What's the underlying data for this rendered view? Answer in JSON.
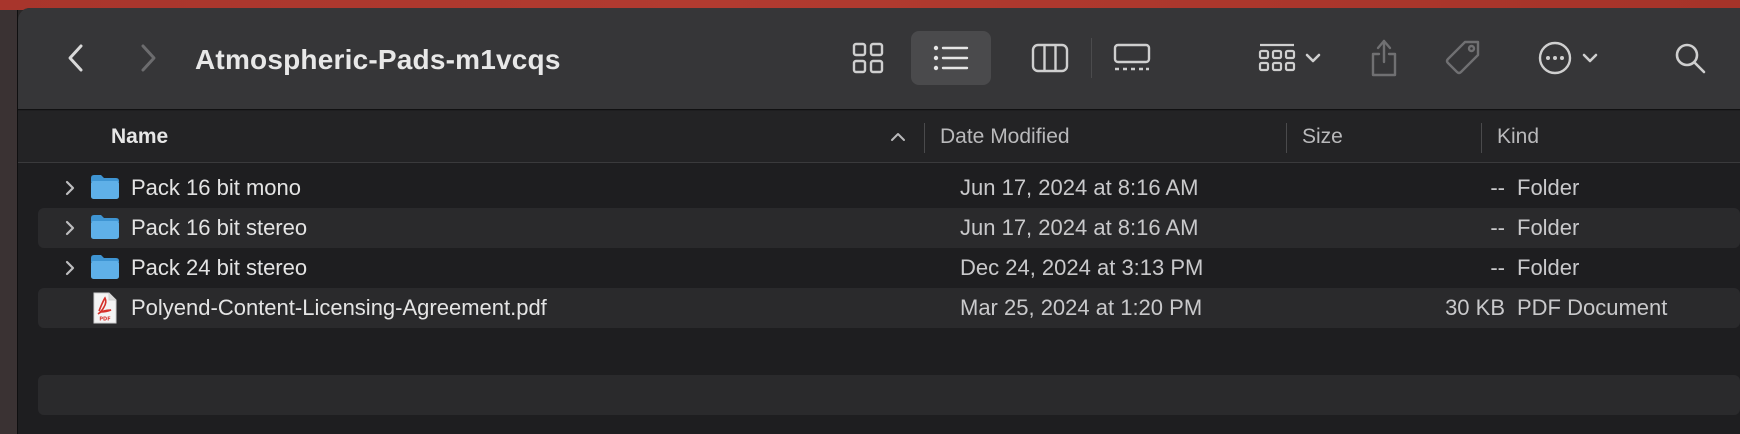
{
  "window": {
    "title": "Atmospheric-Pads-m1vcqs"
  },
  "toolbar": {
    "back": "chevron-left-icon",
    "forward": "chevron-right-icon",
    "views": [
      "icon-view-icon",
      "list-view-icon",
      "column-view-icon",
      "gallery-view-icon"
    ],
    "selected_view": "list",
    "group": "group-icon",
    "share": "share-icon",
    "tags": "tag-icon",
    "more": "ellipsis-circle-icon",
    "search": "search-icon"
  },
  "columns": {
    "name": "Name",
    "date": "Date Modified",
    "size": "Size",
    "kind": "Kind"
  },
  "files": [
    {
      "name": "Pack 16 bit mono",
      "date": "Jun 17, 2024 at 8:16 AM",
      "size": "--",
      "kind": "Folder",
      "type": "folder"
    },
    {
      "name": "Pack 16 bit stereo",
      "date": "Jun 17, 2024 at 8:16 AM",
      "size": "--",
      "kind": "Folder",
      "type": "folder"
    },
    {
      "name": "Pack 24 bit stereo",
      "date": "Dec 24, 2024 at 3:13 PM",
      "size": "--",
      "kind": "Folder",
      "type": "folder"
    },
    {
      "name": "Polyend-Content-Licensing-Agreement.pdf",
      "date": "Mar 25, 2024 at 1:20 PM",
      "size": "30 KB",
      "kind": "PDF Document",
      "type": "pdf"
    }
  ],
  "colors": {
    "folder": "#5fb0e8",
    "pdf_red": "#d6312b",
    "selected_view_bg": "#4a4a4c"
  }
}
